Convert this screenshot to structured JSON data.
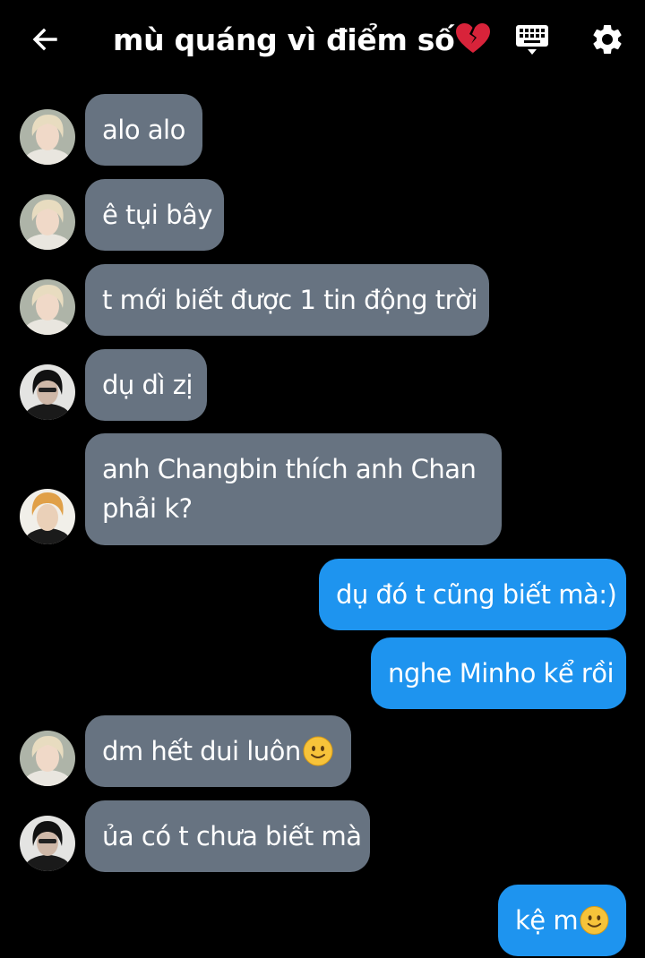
{
  "header": {
    "title": "mù quáng vì điểm số",
    "title_emoji": "broken-heart-icon"
  },
  "colors": {
    "background": "#000000",
    "incoming_bubble": "#677381",
    "outgoing_bubble": "#1e94ef",
    "text": "#ffffff"
  },
  "messages": [
    {
      "side": "in",
      "avatar": "avatar-blonde",
      "text": "alo alo"
    },
    {
      "side": "in",
      "avatar": "avatar-blonde",
      "text": "ê tụi bây"
    },
    {
      "side": "in",
      "avatar": "avatar-blonde",
      "text": "t mới biết được 1 tin động trời"
    },
    {
      "side": "in",
      "avatar": "avatar-dark-hair",
      "text": "dụ dì zị"
    },
    {
      "side": "in",
      "avatar": "avatar-orange-hair",
      "text": "anh Changbin thích anh Chan phải k?"
    },
    {
      "side": "out",
      "text": "dụ đó t cũng biết mà:)"
    },
    {
      "side": "out",
      "text": "nghe Minho kể rồi"
    },
    {
      "side": "in",
      "avatar": "avatar-blonde",
      "text": "dm hết dui luôn",
      "emoji": "slight-smile-icon"
    },
    {
      "side": "in",
      "avatar": "avatar-dark-hair",
      "text": "ủa có t chưa biết mà"
    },
    {
      "side": "out",
      "text": "kệ m",
      "emoji": "slight-smile-icon"
    }
  ]
}
